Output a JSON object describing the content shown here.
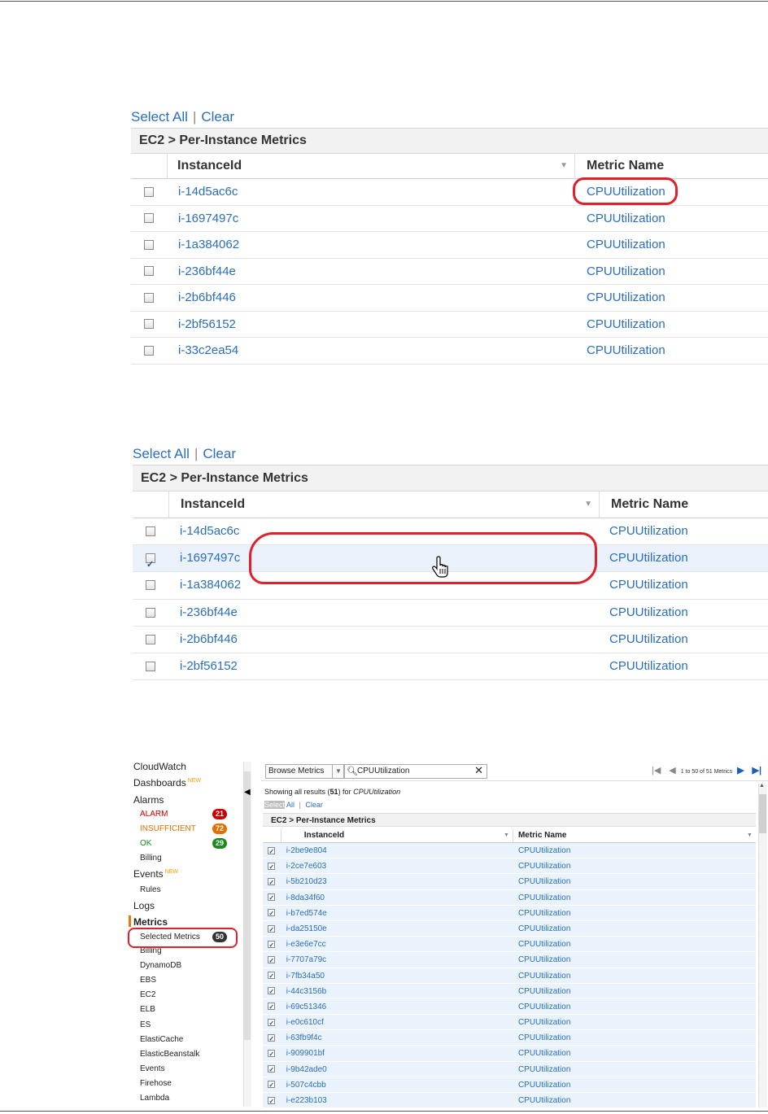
{
  "panel1": {
    "select_all": "Select All",
    "separator": "|",
    "clear": "Clear",
    "group_title": "EC2 > Per-Instance Metrics",
    "col_instance": "InstanceId",
    "col_metric": "Metric Name",
    "rows": [
      {
        "id": "i-14d5ac6c",
        "metric": "CPUUtilization",
        "checked": false
      },
      {
        "id": "i-1697497c",
        "metric": "CPUUtilization",
        "checked": false
      },
      {
        "id": "i-1a384062",
        "metric": "CPUUtilization",
        "checked": false
      },
      {
        "id": "i-236bf44e",
        "metric": "CPUUtilization",
        "checked": false
      },
      {
        "id": "i-2b6bf446",
        "metric": "CPUUtilization",
        "checked": false
      },
      {
        "id": "i-2bf56152",
        "metric": "CPUUtilization",
        "checked": false
      },
      {
        "id": "i-33c2ea54",
        "metric": "CPUUtilization",
        "checked": false
      }
    ]
  },
  "panel2": {
    "select_all": "Select All",
    "separator": "|",
    "clear": "Clear",
    "group_title": "EC2 > Per-Instance Metrics",
    "col_instance": "InstanceId",
    "col_metric": "Metric Name",
    "rows": [
      {
        "id": "i-14d5ac6c",
        "metric": "CPUUtilization",
        "checked": false
      },
      {
        "id": "i-1697497c",
        "metric": "CPUUtilization",
        "checked": true
      },
      {
        "id": "i-1a384062",
        "metric": "CPUUtilization",
        "checked": false
      },
      {
        "id": "i-236bf44e",
        "metric": "CPUUtilization",
        "checked": false
      },
      {
        "id": "i-2b6bf446",
        "metric": "CPUUtilization",
        "checked": false
      },
      {
        "id": "i-2bf56152",
        "metric": "CPUUtilization",
        "checked": false
      }
    ]
  },
  "console": {
    "nav": {
      "cloudwatch": "CloudWatch",
      "dashboards": "Dashboards",
      "new": "NEW",
      "alarms": "Alarms",
      "alarm": "ALARM",
      "alarm_count": "21",
      "insufficient": "INSUFFICIENT",
      "insufficient_count": "72",
      "ok": "OK",
      "ok_count": "29",
      "billing": "Billing",
      "events": "Events",
      "rules": "Rules",
      "logs": "Logs",
      "metrics": "Metrics",
      "selected_metrics": "Selected Metrics",
      "selected_count": "50",
      "metric_items": [
        "Billing",
        "DynamoDB",
        "EBS",
        "EC2",
        "ELB",
        "ES",
        "ElastiCache",
        "ElasticBeanstalk",
        "Events",
        "Firehose",
        "Lambda"
      ]
    },
    "toolbar": {
      "browse": "Browse Metrics",
      "search_value": "CPUUtilization",
      "pager_text": "1 to 50 of 51 Metrics"
    },
    "showing_prefix": "Showing all results (",
    "showing_count": "51",
    "showing_mid": ") for ",
    "showing_term": "CPUUtilization",
    "select_part1": "Select",
    "select_part2": " All",
    "separator": "|",
    "clear": "Clear",
    "group_title": "EC2 > Per-Instance Metrics",
    "col_instance": "InstanceId",
    "col_metric": "Metric Name",
    "rows": [
      {
        "id": "i-2be9e804",
        "metric": "CPUUtilization"
      },
      {
        "id": "i-2ce7e603",
        "metric": "CPUUtilization"
      },
      {
        "id": "i-5b210d23",
        "metric": "CPUUtilization"
      },
      {
        "id": "i-8da34f60",
        "metric": "CPUUtilization"
      },
      {
        "id": "i-b7ed574e",
        "metric": "CPUUtilization"
      },
      {
        "id": "i-da25150e",
        "metric": "CPUUtilization"
      },
      {
        "id": "i-e3e6e7cc",
        "metric": "CPUUtilization"
      },
      {
        "id": "i-7707a79c",
        "metric": "CPUUtilization"
      },
      {
        "id": "i-7fb34a50",
        "metric": "CPUUtilization"
      },
      {
        "id": "i-44c3156b",
        "metric": "CPUUtilization"
      },
      {
        "id": "i-69c51346",
        "metric": "CPUUtilization"
      },
      {
        "id": "i-e0c610cf",
        "metric": "CPUUtilization"
      },
      {
        "id": "i-63fb9f4c",
        "metric": "CPUUtilization"
      },
      {
        "id": "i-909901bf",
        "metric": "CPUUtilization"
      },
      {
        "id": "i-9b42ade0",
        "metric": "CPUUtilization"
      },
      {
        "id": "i-507c4cbb",
        "metric": "CPUUtilization"
      },
      {
        "id": "i-e223b103",
        "metric": "CPUUtilization"
      }
    ]
  },
  "colors": {
    "link": "#2a6ebb",
    "highlight": "#e0202c",
    "alarm": "#cc0000",
    "insufficient": "#e07000",
    "ok": "#1e8a1e",
    "selected_row": "#eaf2fc"
  }
}
